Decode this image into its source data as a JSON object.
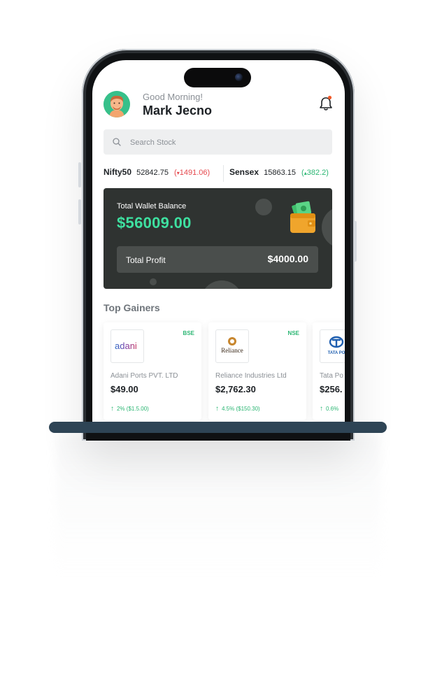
{
  "header": {
    "greeting": "Good Morning!",
    "username": "Mark Jecno"
  },
  "search": {
    "placeholder": "Search Stock"
  },
  "indices": [
    {
      "name": "Nifty50",
      "value": "52842.75",
      "change": "1491.06"
    },
    {
      "name": "Sensex",
      "value": "15863.15",
      "change": "382.2"
    }
  ],
  "wallet": {
    "label": "Total Wallet Balance",
    "amount": "$56009.00",
    "profit_label": "Total Profit",
    "profit_value": "$4000.00"
  },
  "top_gainers": {
    "title": "Top Gainers",
    "cards": [
      {
        "exchange": "BSE",
        "logo_text": "adani",
        "name": "Adani Ports PVT. LTD",
        "price": "$49.00",
        "change": "2% ($1.5.00)"
      },
      {
        "exchange": "NSE",
        "logo_text": "Reliance",
        "name": "Reliance Industries Ltd",
        "price": "$2,762.30",
        "change": "4.5% ($150.30)"
      },
      {
        "exchange": "",
        "logo_text": "TATA PO",
        "name": "Tata Po",
        "price": "$256.",
        "change": "0.6%"
      }
    ]
  },
  "colors": {
    "accent_green": "#3ee0a0",
    "gain_green": "#2bb673",
    "loss_red": "#e5484d",
    "card_dark": "#2f3331"
  }
}
